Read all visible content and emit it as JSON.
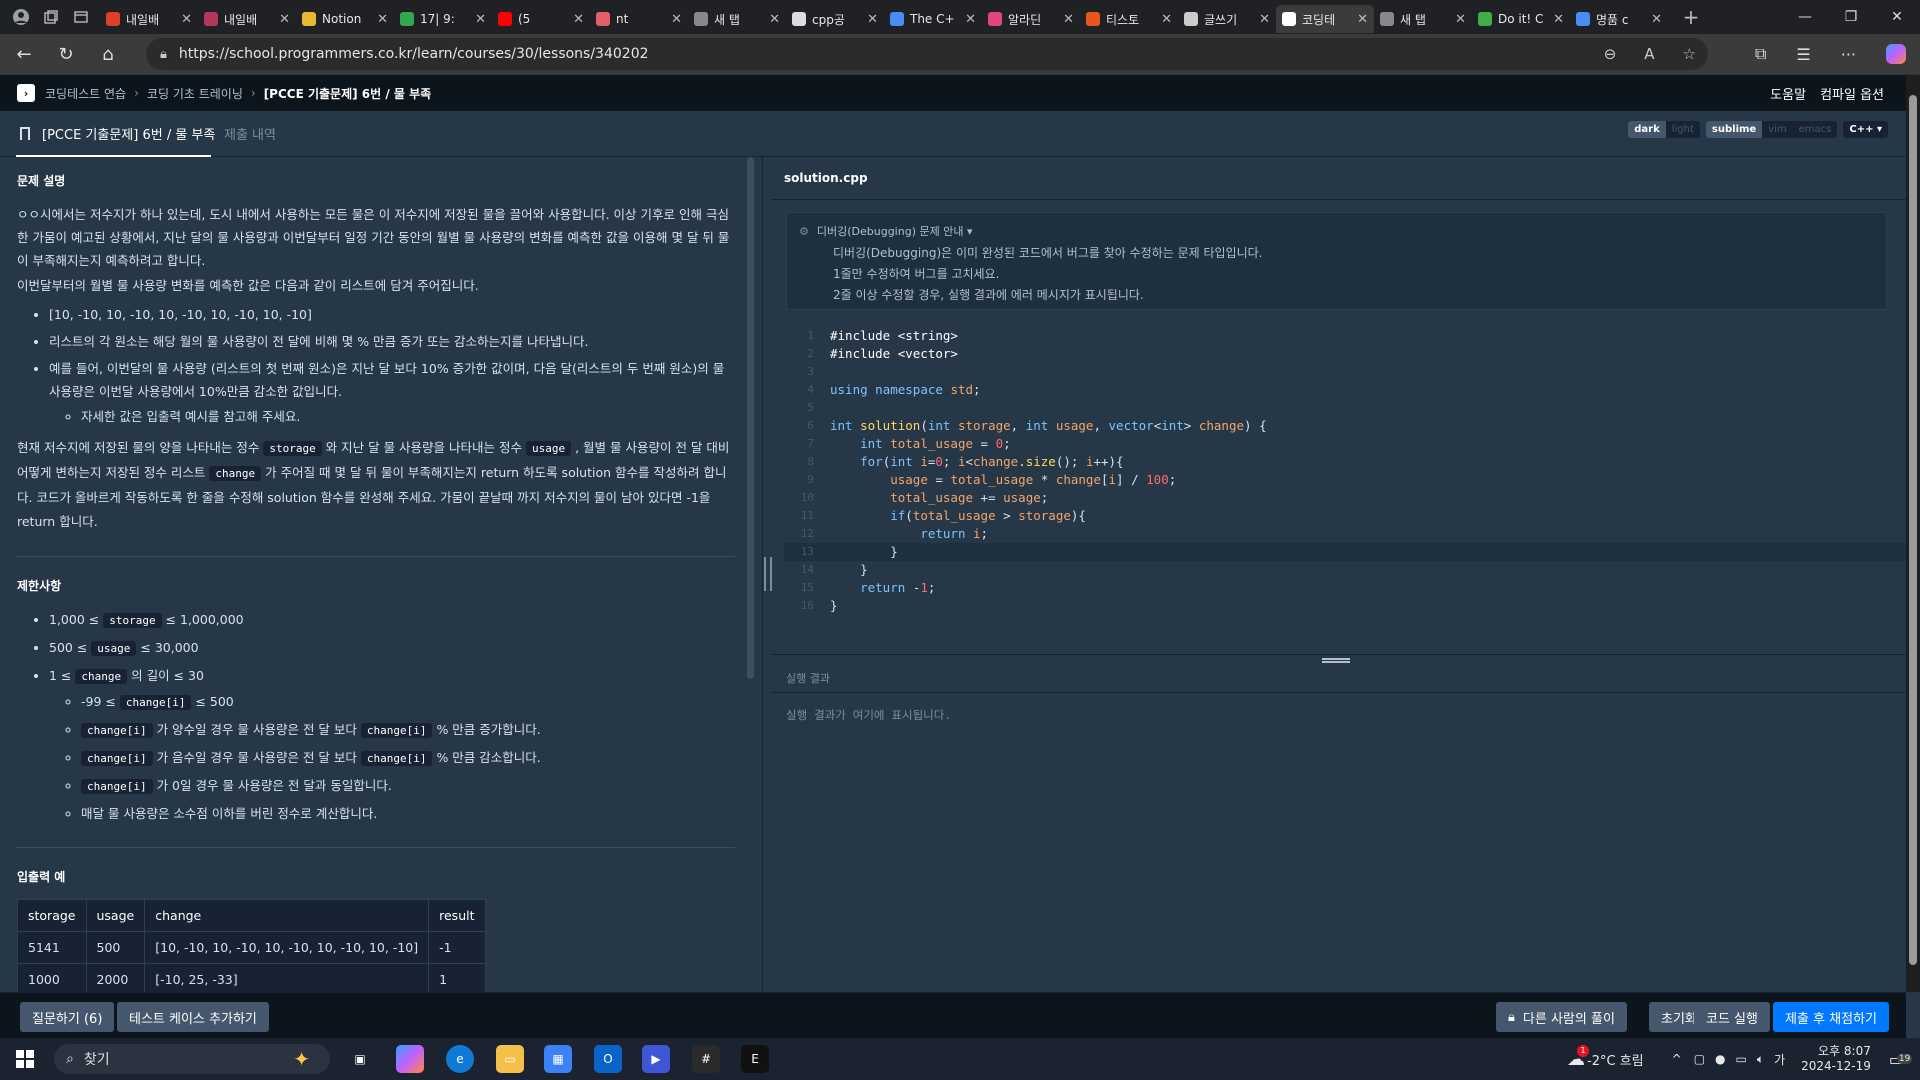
{
  "browser": {
    "tabs": [
      {
        "title": "내일배",
        "icon": "alarm-icon",
        "color": "#e03e2d"
      },
      {
        "title": "내일배",
        "icon": "heart-icon",
        "color": "#b03a5b"
      },
      {
        "title": "Notion",
        "icon": "star-icon",
        "color": "#e8b92e"
      },
      {
        "title": "17| 9:",
        "icon": "clover-icon",
        "color": "#2fa84f"
      },
      {
        "title": "(5",
        "icon": "youtube-icon",
        "color": "#ff0000"
      },
      {
        "title": "nt",
        "icon": "record-icon",
        "color": "#e35d6a"
      },
      {
        "title": "새 탭",
        "icon": "newtab-icon",
        "color": "#888888"
      },
      {
        "title": "cpp공",
        "icon": "github-icon",
        "color": "#dddddd"
      },
      {
        "title": "The C+",
        "icon": "search-icon",
        "color": "#4a8cf7"
      },
      {
        "title": "알라딘",
        "icon": "aladin-icon",
        "color": "#e0457b"
      },
      {
        "title": "티스토",
        "icon": "tistory-icon",
        "color": "#eb531f"
      },
      {
        "title": "글쓰기",
        "icon": "document-icon",
        "color": "#cccccc"
      },
      {
        "title": "코딩테",
        "icon": "programmers-icon",
        "color": "#ffffff"
      },
      {
        "title": "새 탭",
        "icon": "newtab-icon",
        "color": "#888888"
      },
      {
        "title": "Do it! C",
        "icon": "leaf-icon",
        "color": "#3fae49"
      },
      {
        "title": "명품 c",
        "icon": "search-icon",
        "color": "#4a8cf7"
      }
    ],
    "active_tab_index": 12,
    "url": "https://school.programmers.co.kr/learn/courses/30/lessons/340202"
  },
  "header": {
    "breadcrumb": [
      "코딩테스트 연습",
      "코딩 기초 트레이닝",
      "[PCCE 기출문제] 6번 / 물 부족"
    ],
    "help": "도움말",
    "compile_options": "컴파일 옵션"
  },
  "lesson_tabs": {
    "problem": "[PCCE 기출문제] 6번 / 물 부족",
    "submissions": "제출 내역"
  },
  "editor_options": {
    "themes": [
      "dark",
      "light"
    ],
    "keymaps": [
      "sublime",
      "vim",
      "emacs"
    ],
    "language": "C++ ▾",
    "active_theme": "dark",
    "active_keymap": "sublime"
  },
  "problem": {
    "title": "문제 설명",
    "para1": "ㅇㅇ시에서는 저수지가 하나 있는데, 도시 내에서 사용하는 모든 물은 이 저수지에 저장된 물을 끌어와 사용합니다. 이상 기후로 인해 극심한 가뭄이 예고된 상황에서, 지난 달의 물 사용량과 이번달부터 일정 기간 동안의 월별 물 사용량의 변화를 예측한 값을 이용해 몇 달 뒤 물이 부족해지는지 예측하려고 합니다.",
    "para2": "이번달부터의 월별 물 사용량 변화를 예측한 값은 다음과 같이 리스트에 담겨 주어집니다.",
    "bullets": [
      "[10, -10, 10, -10, 10, -10, 10, -10, 10, -10]",
      "리스트의 각 원소는 해당 월의 물 사용량이 전 달에 비해 몇 % 만큼 증가 또는 감소하는지를 나타냅니다.",
      "예를 들어, 이번달의 물 사용량 (리스트의 첫 번째 원소)은 지난 달 보다 10% 증가한 값이며, 다음 달(리스트의 두 번째 원소)의 물 사용량은 이번달 사용량에서 10%만큼 감소한 값입니다."
    ],
    "sub_bullet": "자세한 값은 입출력 예시를 참고해 주세요.",
    "p3_a": "현재 저수지에 저장된 물의 양을 나타내는 정수 ",
    "p3_code1": "storage",
    "p3_b": " 와 지난 달 물 사용량을 나타내는 정수 ",
    "p3_code2": "usage",
    "p3_c": " , 월별 물 사용량이 전 달 대비 어떻게 변하는지 저장된 정수 리스트 ",
    "p3_code3": "change",
    "p3_d": " 가 주어질 때 몇 달 뒤 물이 부족해지는지 return 하도록 solution 함수를 작성하려 합니다. 코드가 올바르게 작동하도록 한 줄을 수정해 solution 함수를 완성해 주세요. 가뭄이 끝날때 까지 저수지의 물이 남아 있다면 -1을 return 합니다."
  },
  "constraints": {
    "title": "제한사항",
    "c1_pre": "1,000 ≤ ",
    "c1_code": "storage",
    "c1_post": " ≤ 1,000,000",
    "c2_pre": "500 ≤ ",
    "c2_code": "usage",
    "c2_post": " ≤ 30,000",
    "c3_pre": "1 ≤ ",
    "c3_code": "change",
    "c3_post": " 의 길이 ≤ 30",
    "s1_pre": "-99 ≤ ",
    "s1_code": "change[i]",
    "s1_post": " ≤ 500",
    "s2_code": "change[i]",
    "s2_mid": " 가 양수일 경우 물 사용량은 전 달 보다 ",
    "s2_code2": "change[i]",
    "s2_post": " % 만큼 증가합니다.",
    "s3_code": "change[i]",
    "s3_mid": " 가 음수일 경우 물 사용량은 전 달 보다 ",
    "s3_code2": "change[i]",
    "s3_post": " % 만큼 감소합니다.",
    "s4_code": "change[i]",
    "s4_post": " 가 0일 경우 물 사용량은 전 달과 동일합니다.",
    "s5": "매달 물 사용량은 소수점 이하를 버린 정수로 계산합니다."
  },
  "examples": {
    "title": "입출력 예",
    "headers": [
      "storage",
      "usage",
      "change",
      "result"
    ],
    "rows": [
      [
        "5141",
        "500",
        "[10, -10, 10, -10, 10, -10, 10, -10, 10, -10]",
        "-1"
      ],
      [
        "1000",
        "2000",
        "[-10, 25, -33]",
        "1"
      ]
    ]
  },
  "editor": {
    "filename": "solution.cpp",
    "debug_title": "디버깅(Debugging) 문제 안내 ▾",
    "debug_lines": [
      "디버깅(Debugging)은 이미 완성된 코드에서 버그를 찾아 수정하는 문제 타입입니다.",
      "1줄만 수정하여 버그를 고치세요.",
      "2줄 이상 수정할 경우, 실행 결과에 에러 메시지가 표시됩니다."
    ],
    "code_lines": [
      "#include <string>",
      "#include <vector>",
      "",
      "using namespace std;",
      "",
      "int solution(int storage, int usage, vector<int> change) {",
      "    int total_usage = 0;",
      "    for(int i=0; i<change.size(); i++){",
      "        usage = total_usage * change[i] / 100;",
      "        total_usage += usage;",
      "        if(total_usage > storage){",
      "            return i;",
      "        }",
      "    }",
      "    return -1;",
      "}"
    ],
    "current_line": 13,
    "result_label": "실행 결과",
    "result_msg": "실행 결과가 여기에 표시됩니다."
  },
  "footer": {
    "ask": "질문하기 (6)",
    "add_test": "테스트 케이스 추가하기",
    "others": "다른 사람의 풀이",
    "reset": "초기화",
    "run": "코드 실행",
    "submit": "제출 후 채점하기"
  },
  "taskbar": {
    "search": "찾기",
    "weather": "-2°C 흐림",
    "time": "오후 8:07",
    "date": "2024-12-19",
    "ime": "가",
    "notifications": "19",
    "weather_badge": "1"
  }
}
